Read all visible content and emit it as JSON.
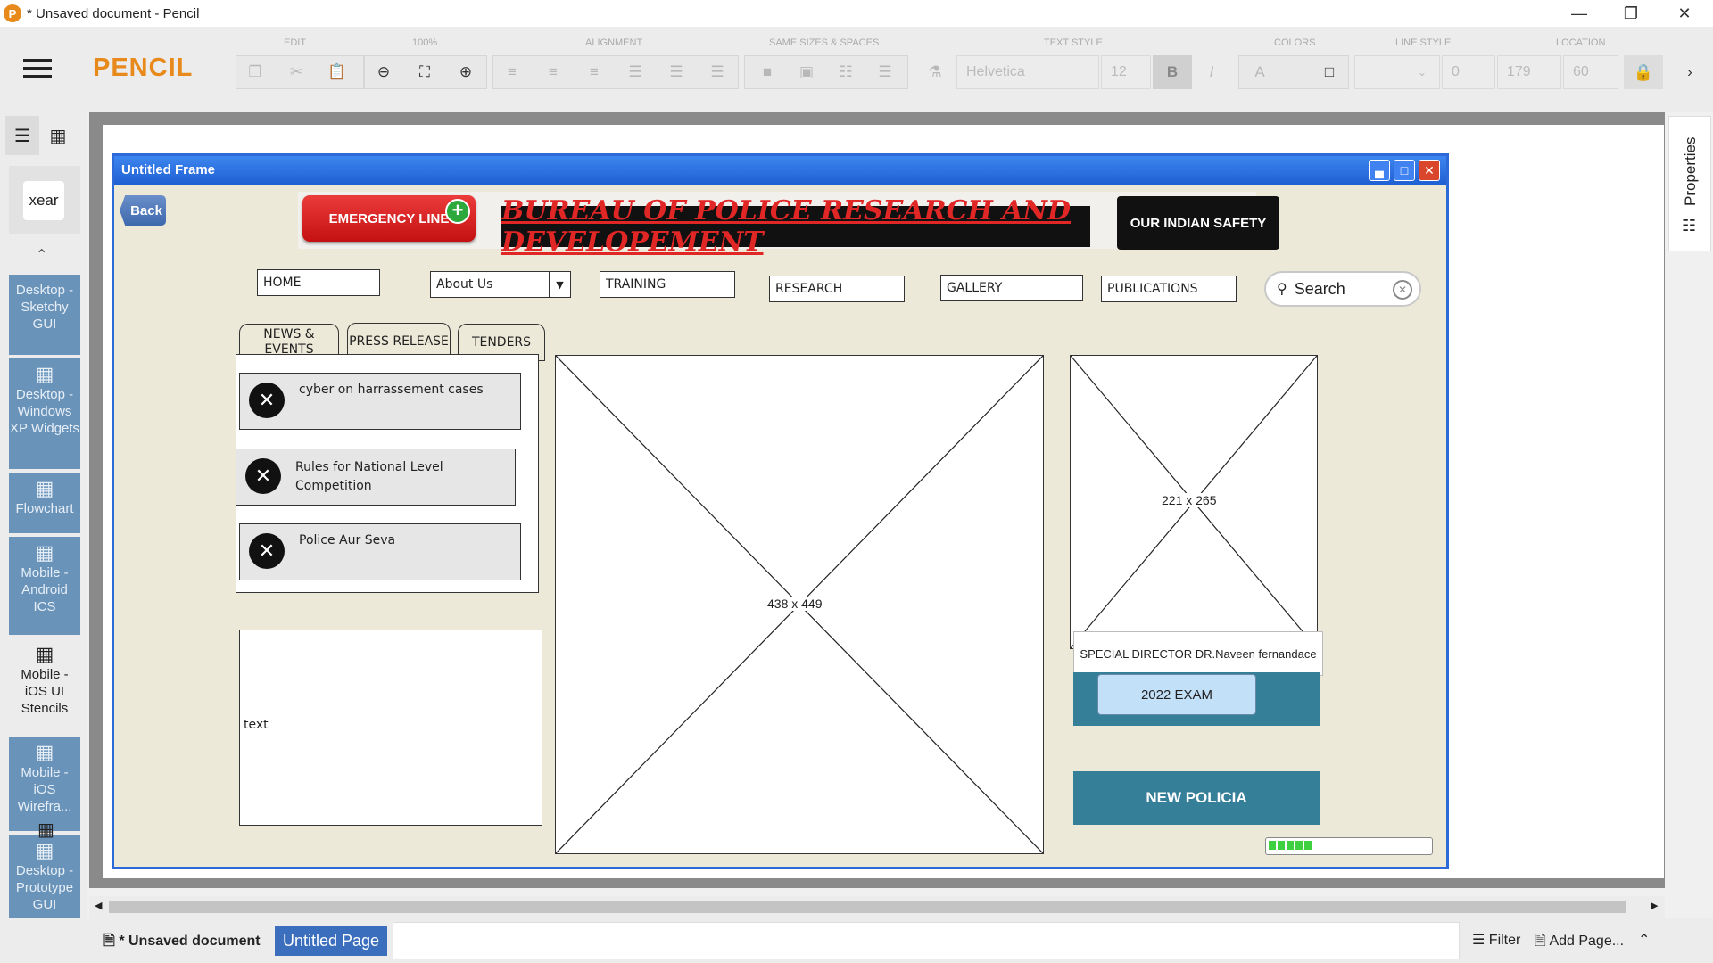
{
  "window": {
    "title": "* Unsaved document - Pencil",
    "app_icon": "P"
  },
  "toolbar": {
    "brand": "PENCIL",
    "groups": [
      "EDIT",
      "100%",
      "ALIGNMENT",
      "SAME SIZES & SPACES",
      "TEXT STYLE",
      "COLORS",
      "LINE STYLE",
      "LOCATION"
    ],
    "font_name": "Helvetica",
    "font_size": "12",
    "bold": "B",
    "italic": "I",
    "text_color": "A",
    "line_width": "0",
    "location_x": "179",
    "location_y": "60"
  },
  "sidebar": {
    "search_value": "xear",
    "categories": [
      {
        "label": "Desktop - Sketchy GUI"
      },
      {
        "label": "Desktop - Windows XP Widgets"
      },
      {
        "label": "Flowchart"
      },
      {
        "label": "Mobile - Android ICS"
      },
      {
        "label": "Mobile - iOS UI Stencils"
      },
      {
        "label": "Mobile - iOS Wirefra..."
      },
      {
        "label": "Desktop - Prototype GUI"
      }
    ]
  },
  "properties": {
    "label": "Properties"
  },
  "frame": {
    "title": "Untitled Frame",
    "back": "Back",
    "emergency": "EMERGENCY LINE",
    "banner": "BUREAU OF POLICE RESEARCH AND DEVELOPEMENT",
    "safety": "OUR INDIAN SAFETY",
    "nav": {
      "home": "HOME",
      "about": "About Us",
      "training": "TRAINING",
      "research": "RESEARCH",
      "gallery": "GALLERY",
      "publications": "PUBLICATIONS"
    },
    "search_placeholder": "Search",
    "tabs": [
      "NEWS & EVENTS",
      "PRESS RELEASE",
      "TENDERS"
    ],
    "news": [
      "cyber on harrassement cases",
      "Rules for National Level Competition",
      "Police Aur Seva"
    ],
    "textbox": "text",
    "center_image": "438 x 449",
    "right_image": "221 x 265",
    "director": "SPECIAL DIRECTOR DR.Naveen fernandace",
    "exam": "2022 EXAM",
    "policia": "NEW POLICIA",
    "progress": {
      "filled_segments": 5
    }
  },
  "status": {
    "document": "* Unsaved document",
    "page_tab": "Untitled Page",
    "filter": "Filter",
    "add_page": "Add Page..."
  }
}
